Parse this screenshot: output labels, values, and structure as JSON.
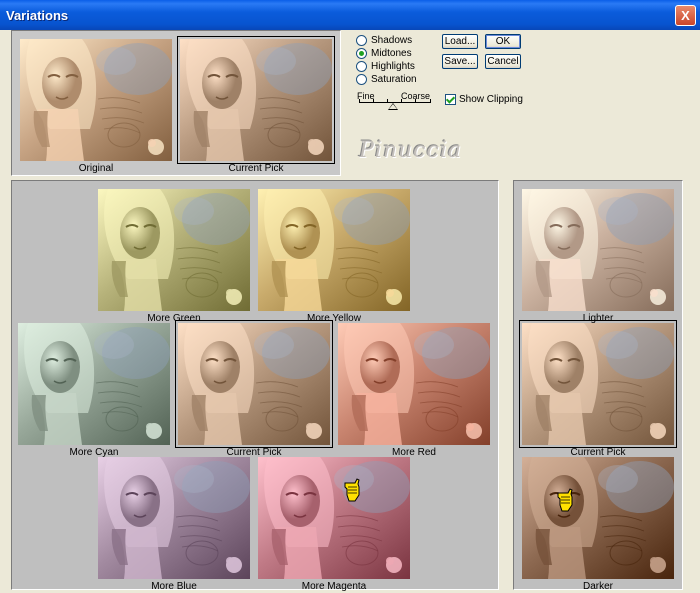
{
  "window": {
    "title": "Variations",
    "close_label": "X"
  },
  "tones": {
    "options": [
      "Shadows",
      "Midtones",
      "Highlights",
      "Saturation"
    ],
    "selected": "Midtones"
  },
  "buttons": {
    "load": "Load...",
    "ok": "OK",
    "save": "Save...",
    "cancel": "Cancel"
  },
  "slider": {
    "fine_label": "Fine",
    "coarse_label": "Coarse",
    "level": 0.45
  },
  "show_clipping": {
    "label": "Show Clipping",
    "checked": true
  },
  "watermark": "Pinuccia",
  "top": {
    "original_label": "Original",
    "current_label": "Current Pick"
  },
  "hue": {
    "more_green": "More Green",
    "more_yellow": "More Yellow",
    "more_cyan": "More Cyan",
    "current": "Current Pick",
    "more_red": "More Red",
    "more_blue": "More Blue",
    "more_magenta": "More Magenta"
  },
  "brightness": {
    "lighter": "Lighter",
    "current": "Current Pick",
    "darker": "Darker"
  },
  "tints": {
    "original": "#c8a585",
    "current": "#b89a80",
    "more_green": "#b6b27a",
    "more_yellow": "#c9ab6c",
    "more_cyan": "#98a89a",
    "more_red": "#c98570",
    "more_blue": "#a28aa0",
    "more_magenta": "#c07a86",
    "lighter": "#cbb2a0",
    "darker": "#8e6a52"
  },
  "cursor_icon": "pointing-hand-icon"
}
